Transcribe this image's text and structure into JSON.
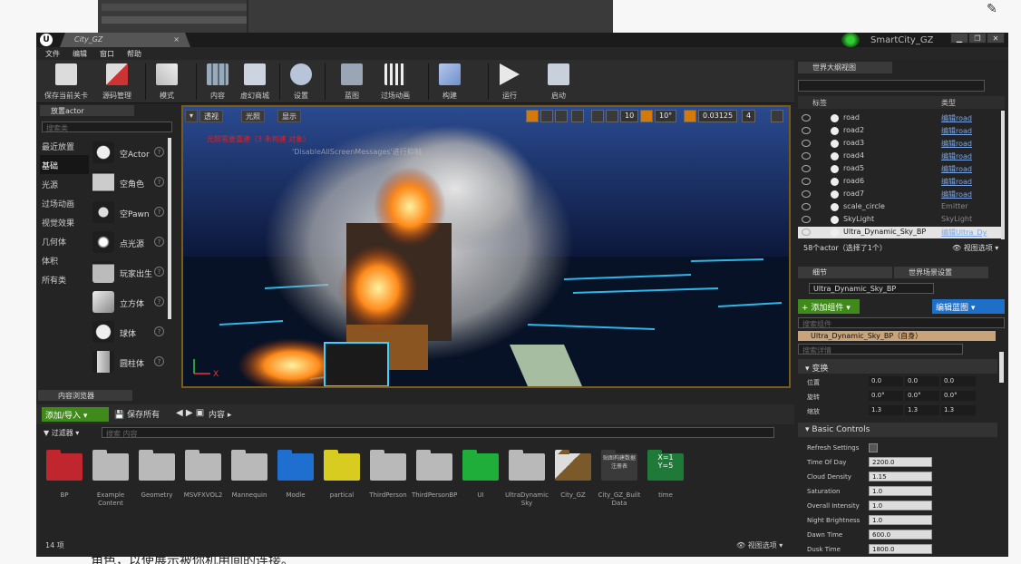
{
  "window": {
    "doc_tab": "City_GZ",
    "project_name": "SmartCity_GZ"
  },
  "menu": [
    "文件",
    "编辑",
    "窗口",
    "帮助"
  ],
  "toolbar": [
    {
      "label": "保存当前关卡",
      "icon": "save-icon"
    },
    {
      "label": "源码管理",
      "icon": "source-control-icon"
    },
    {
      "label": "模式",
      "icon": "modes-icon"
    },
    {
      "label": "内容",
      "icon": "content-icon"
    },
    {
      "label": "虚幻商城",
      "icon": "marketplace-icon"
    },
    {
      "label": "设置",
      "icon": "settings-icon"
    },
    {
      "label": "蓝图",
      "icon": "blueprint-icon"
    },
    {
      "label": "过场动画",
      "icon": "cinematics-icon"
    },
    {
      "label": "构建",
      "icon": "build-icon"
    },
    {
      "label": "运行",
      "icon": "play-icon"
    },
    {
      "label": "启动",
      "icon": "launch-icon"
    }
  ],
  "place_panel": {
    "tab": "放置actor",
    "search_placeholder": "搜索类",
    "categories": [
      "最近放置",
      "基础",
      "光源",
      "过场动画",
      "视觉效果",
      "几何体",
      "体积",
      "所有类"
    ],
    "active_category": "基础",
    "items": [
      "空Actor",
      "空角色",
      "空Pawn",
      "点光源",
      "玩家出生",
      "立方体",
      "球体",
      "圆柱体"
    ]
  },
  "viewport": {
    "perspective": "透视",
    "lit": "光照",
    "show": "显示",
    "warning": "光照需要重建（3 未构建 对象）",
    "warning2": "'DisableAllScreenMessages'进行抑制",
    "grid_snap": "10",
    "rot_snap": "10°",
    "scale_snap": "0.03125",
    "camera_speed": "4",
    "axis_x": "X"
  },
  "content_browser": {
    "tab": "内容浏览器",
    "add_import": "添加/导入",
    "save_all": "保存所有",
    "path": "内容",
    "filters": "过滤器",
    "search_placeholder": "搜索 内容",
    "assets": [
      {
        "label": "BP",
        "color": "#c0262d"
      },
      {
        "label": "Example Content",
        "color": "#b9b9b9"
      },
      {
        "label": "Geometry",
        "color": "#b9b9b9"
      },
      {
        "label": "MSVFXVOL2",
        "color": "#b9b9b9"
      },
      {
        "label": "Mannequin",
        "color": "#b9b9b9"
      },
      {
        "label": "Modle",
        "color": "#1f6fd0"
      },
      {
        "label": "partical",
        "color": "#d8cc20"
      },
      {
        "label": "ThirdPerson",
        "color": "#b9b9b9"
      },
      {
        "label": "ThirdPersonBP",
        "color": "#b9b9b9"
      },
      {
        "label": "UI",
        "color": "#1fae3a"
      },
      {
        "label": "UltraDynamic Sky",
        "color": "#b9b9b9"
      },
      {
        "label": "City_GZ",
        "color": "#7a5a2a"
      },
      {
        "label": "City_GZ_Built Data",
        "color": "#b9b9b9"
      },
      {
        "label": "time",
        "color": "#1f7a3a"
      }
    ],
    "map_data_caption": "贴图构建数据注册表",
    "time_icon_text": "X=1\nY=5",
    "count": "14 项",
    "view_options": "视图选项"
  },
  "outliner": {
    "tab": "世界大纲视图",
    "col_label": "标签",
    "col_type": "类型",
    "rows": [
      {
        "name": "road",
        "type": "编辑road",
        "link": true
      },
      {
        "name": "road2",
        "type": "编辑road",
        "link": true
      },
      {
        "name": "road3",
        "type": "编辑road",
        "link": true
      },
      {
        "name": "road4",
        "type": "编辑road",
        "link": true
      },
      {
        "name": "road5",
        "type": "编辑road",
        "link": true
      },
      {
        "name": "road6",
        "type": "编辑road",
        "link": true
      },
      {
        "name": "road7",
        "type": "编辑road",
        "link": true
      },
      {
        "name": "scale_circle",
        "type": "Emitter",
        "link": false
      },
      {
        "name": "SkyLight",
        "type": "SkyLight",
        "link": false
      },
      {
        "name": "Ultra_Dynamic_Sky_BP",
        "type": "编辑Ultra_Dy",
        "link": true,
        "selected": true
      }
    ],
    "count": "58个actor（选择了1个）",
    "view_options": "视图选项"
  },
  "details": {
    "tab": "细节",
    "tab2": "世界场景设置",
    "actor_name": "Ultra_Dynamic_Sky_BP",
    "add_component": "添加组件",
    "edit_blueprint": "编辑蓝图",
    "component_search": "搜索组件",
    "self_row": "Ultra_Dynamic_Sky_BP（自身）",
    "details_search": "搜索详情",
    "transform_section": "变换",
    "location_label": "位置",
    "rotation_label": "旋转",
    "scale_label": "缩放",
    "location": [
      "0.0",
      "0.0",
      "0.0"
    ],
    "rotation": [
      "0.0°",
      "0.0°",
      "0.0°"
    ],
    "scale": [
      "1.3",
      "1.3",
      "1.3"
    ],
    "basic_section": "Basic Controls",
    "props": [
      {
        "label": "Refresh Settings",
        "value": ""
      },
      {
        "label": "Time Of Day",
        "value": "2200.0"
      },
      {
        "label": "Cloud Density",
        "value": "1.15"
      },
      {
        "label": "Saturation",
        "value": "1.0"
      },
      {
        "label": "Overall Intensity",
        "value": "1.0"
      },
      {
        "label": "Night Brightness",
        "value": "1.0"
      },
      {
        "label": "Dawn Time",
        "value": "600.0"
      },
      {
        "label": "Dusk Time",
        "value": "1800.0"
      }
    ]
  },
  "bottom_text": "角色，以使展示被你机用间的连接。"
}
